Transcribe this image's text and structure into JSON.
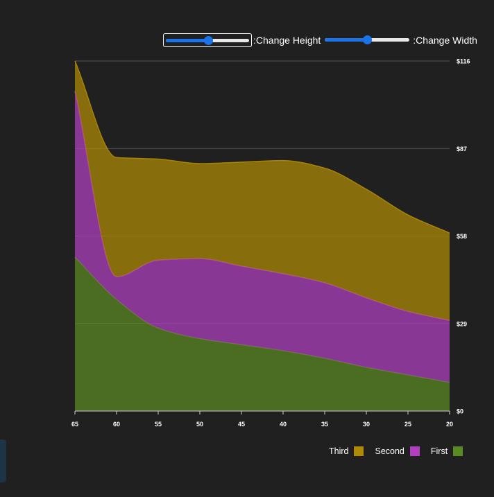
{
  "controls": {
    "height_label": ":Change Height",
    "width_label": ":Change Width",
    "height_value": 0.5,
    "width_value": 0.5
  },
  "colors": {
    "background": "#202020",
    "third": "#b08a06",
    "second": "#b040c0",
    "first": "#5a8a22",
    "grid": "#555555",
    "slider_accent": "#1a73e8"
  },
  "chart_data": {
    "type": "area",
    "stacked": true,
    "x": [
      65,
      60,
      55,
      50,
      45,
      40,
      35,
      30,
      25,
      20
    ],
    "x_ticks": [
      "65",
      "60",
      "55",
      "50",
      "45",
      "40",
      "35",
      "30",
      "25",
      "20"
    ],
    "y_ticks": [
      "$0",
      "$29",
      "$58",
      "$87",
      "$116"
    ],
    "ylim": [
      0,
      116
    ],
    "x_reversed": true,
    "y_axis_position": "right",
    "grid": true,
    "legend_position": "bottom-right",
    "series": [
      {
        "name": "First",
        "color": "#5a8a22",
        "values": [
          51,
          37,
          27.5,
          24,
          22,
          20,
          17.5,
          14.5,
          12,
          9.5
        ]
      },
      {
        "name": "Second",
        "color": "#b040c0",
        "values": [
          55,
          7.5,
          22.5,
          26.5,
          26,
          25.5,
          25,
          23,
          21,
          20.5
        ]
      },
      {
        "name": "Third",
        "color": "#b08a06",
        "values": [
          10,
          39.5,
          33.5,
          31.5,
          34.5,
          37.5,
          38,
          36,
          32,
          29
        ]
      }
    ],
    "legend": [
      "Third",
      "Second",
      "First"
    ]
  }
}
